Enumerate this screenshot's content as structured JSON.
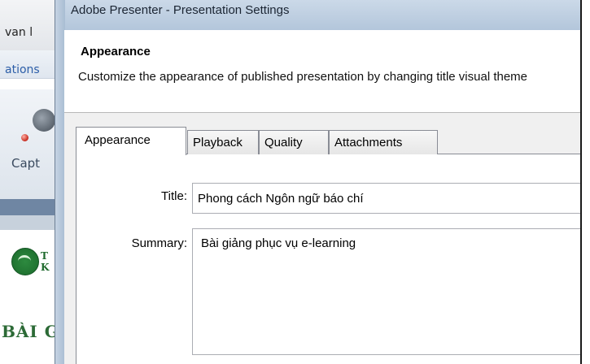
{
  "background_app": {
    "title_fragment": "van l",
    "ribbon_fragment": "ations",
    "tool_label_fragment": "Capt",
    "slide_letter_1": "T",
    "slide_letter_2": "K",
    "slide_heading_fragment": "BÀI G",
    "icons": [
      "webcam-icon",
      "recording-led-icon",
      "university-logo"
    ]
  },
  "dialog": {
    "title": "Adobe Presenter - Presentation Settings",
    "header": {
      "title": "Appearance",
      "description": "Customize the appearance of published presentation by changing title visual theme"
    },
    "tabs": [
      {
        "label": "Appearance",
        "active": true
      },
      {
        "label": "Playback",
        "active": false
      },
      {
        "label": "Quality",
        "active": false
      },
      {
        "label": "Attachments",
        "active": false
      }
    ],
    "fields": {
      "title_label": "Title:",
      "title_value": "Phong cách Ngôn ngữ báo chí",
      "summary_label": "Summary:",
      "summary_value": "Bài giảng phục vụ e-learning"
    }
  },
  "colors": {
    "titlebar": "#b3c6db",
    "slide_green": "#2c6a36",
    "panel_bg": "#f0f0f0"
  }
}
